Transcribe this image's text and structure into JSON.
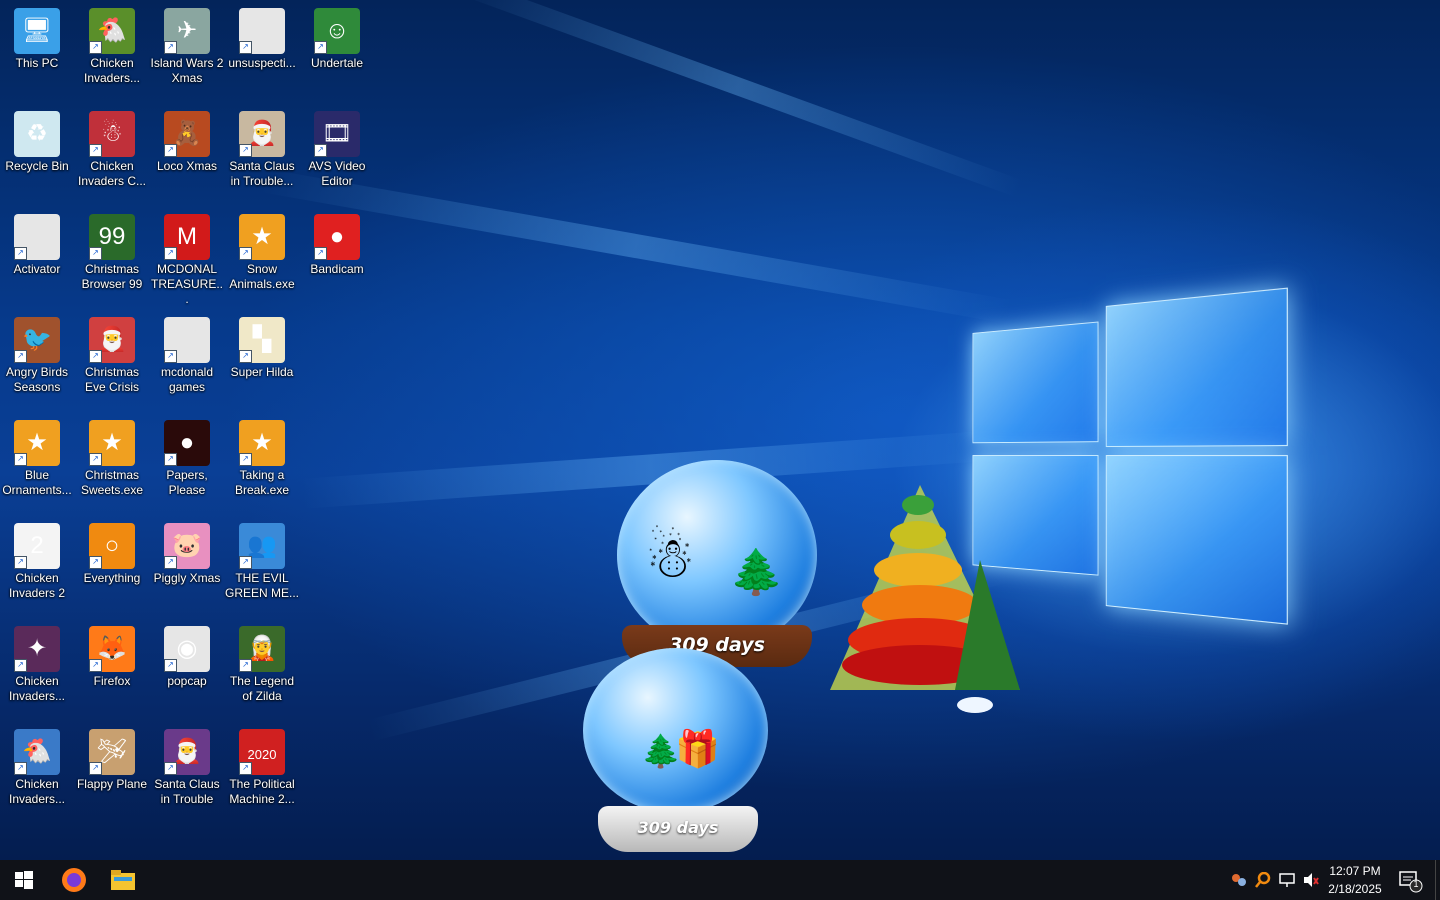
{
  "desktop": {
    "icons": [
      {
        "label": "This PC",
        "icon": "this-pc-icon",
        "color": "#3aa0e8",
        "glyph": "🖥"
      },
      {
        "label": "Chicken Invaders...",
        "icon": "chicken-invaders-icon",
        "color": "#5a8f2a",
        "glyph": "🐔"
      },
      {
        "label": "Island Wars 2 Xmas",
        "icon": "island-wars-icon",
        "color": "#8aa6a0",
        "glyph": "✈"
      },
      {
        "label": "unsuspecti...",
        "icon": "blank-file-icon",
        "color": "#e6e6e6",
        "glyph": ""
      },
      {
        "label": "Undertale",
        "icon": "undertale-icon",
        "color": "#2f8a3a",
        "glyph": "☺"
      },
      {
        "label": "Recycle Bin",
        "icon": "recycle-bin-icon",
        "color": "#cfe8f0",
        "glyph": "♻"
      },
      {
        "label": "Chicken Invaders C...",
        "icon": "chicken-invaders-christmas-icon",
        "color": "#c0303a",
        "glyph": "☃"
      },
      {
        "label": "Loco Xmas",
        "icon": "loco-xmas-icon",
        "color": "#b84a20",
        "glyph": "🧸"
      },
      {
        "label": "Santa Claus in Trouble...",
        "icon": "santa-claus-icon",
        "color": "#c8b8a0",
        "glyph": "🎅"
      },
      {
        "label": "AVS Video Editor",
        "icon": "avs-video-editor-icon",
        "color": "#2a2a6a",
        "glyph": "🎞"
      },
      {
        "label": "Activator",
        "icon": "activator-file-icon",
        "color": "#e6e6e6",
        "glyph": ""
      },
      {
        "label": "Christmas Browser 99",
        "icon": "christmas-browser-icon",
        "color": "#2a6a2a",
        "glyph": "99"
      },
      {
        "label": "MCDONAL TREASURE...",
        "icon": "mcdonald-treasure-icon",
        "color": "#d21a1a",
        "glyph": "M"
      },
      {
        "label": "Snow Animals.exe",
        "icon": "snow-animals-icon",
        "color": "#f0a020",
        "glyph": "★"
      },
      {
        "label": "Bandicam",
        "icon": "bandicam-icon",
        "color": "#e02020",
        "glyph": "●"
      },
      {
        "label": "Angry Birds Seasons",
        "icon": "angry-birds-seasons-icon",
        "color": "#a0522d",
        "glyph": "🐦"
      },
      {
        "label": "Christmas Eve Crisis",
        "icon": "christmas-eve-crisis-icon",
        "color": "#d04040",
        "glyph": "🎅"
      },
      {
        "label": "mcdonald games",
        "icon": "folder-file-icon",
        "color": "#e6e6e6",
        "glyph": ""
      },
      {
        "label": "Super Hilda",
        "icon": "super-hilda-icon",
        "color": "#f0e8c8",
        "glyph": "▚"
      },
      {
        "label": "Blue Ornaments...",
        "icon": "blue-ornaments-icon",
        "color": "#f0a020",
        "glyph": "★"
      },
      {
        "label": "Christmas Sweets.exe",
        "icon": "christmas-sweets-icon",
        "color": "#f0a020",
        "glyph": "★"
      },
      {
        "label": "Papers, Please",
        "icon": "papers-please-icon",
        "color": "#2a0a0a",
        "glyph": "●"
      },
      {
        "label": "Taking a Break.exe",
        "icon": "taking-a-break-icon",
        "color": "#f0a020",
        "glyph": "★"
      },
      {
        "label": "Chicken Invaders 2",
        "icon": "chicken-invaders-2-icon",
        "color": "#f4f4f4",
        "glyph": "2"
      },
      {
        "label": "Everything",
        "icon": "everything-search-icon",
        "color": "#f08a10",
        "glyph": "○"
      },
      {
        "label": "Piggly Xmas",
        "icon": "piggly-xmas-icon",
        "color": "#e890c0",
        "glyph": "🐷"
      },
      {
        "label": "THE EVIL GREEN ME...",
        "icon": "evil-green-messenger-icon",
        "color": "#3a8ad8",
        "glyph": "👥"
      },
      {
        "label": "Chicken Invaders...",
        "icon": "chicken-invaders-3-icon",
        "color": "#5a2a5a",
        "glyph": "✦"
      },
      {
        "label": "Firefox",
        "icon": "firefox-icon",
        "color": "#ff7a18",
        "glyph": "🦊"
      },
      {
        "label": "popcap",
        "icon": "popcap-file-icon",
        "color": "#e6e6e6",
        "glyph": "◉"
      },
      {
        "label": "The Legend of Zilda",
        "icon": "legend-of-zilda-icon",
        "color": "#3a6a2a",
        "glyph": "🧝"
      },
      {
        "label": "Chicken Invaders...",
        "icon": "chicken-invaders-4-icon",
        "color": "#3a7ac8",
        "glyph": "🐔"
      },
      {
        "label": "Flappy Plane",
        "icon": "flappy-plane-icon",
        "color": "#c8a070",
        "glyph": "🛩"
      },
      {
        "label": "Santa Claus in Trouble",
        "icon": "santa-claus-trouble-icon",
        "color": "#6a3a8a",
        "glyph": "🎅"
      },
      {
        "label": "The Political Machine 2...",
        "icon": "political-machine-icon",
        "color": "#d02020",
        "glyph": "2020"
      }
    ]
  },
  "gadgets": {
    "snow_globe_top_days": "309 days",
    "snow_globe_bottom_days": "309 days"
  },
  "taskbar": {
    "start_icon": "windows-start-icon",
    "pinned": [
      {
        "name": "firefox-taskbar-icon",
        "color": "#ff7a18"
      },
      {
        "name": "file-explorer-taskbar-icon",
        "color": "#f4c430"
      }
    ],
    "clock_time": "12:07 PM",
    "clock_date": "2/18/2025",
    "notification_count": "1"
  }
}
